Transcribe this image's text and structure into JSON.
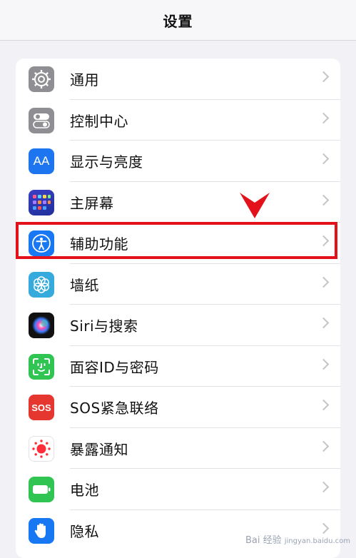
{
  "header": {
    "title": "设置"
  },
  "settings": {
    "items": [
      {
        "label": "通用",
        "icon": "gear-icon"
      },
      {
        "label": "控制中心",
        "icon": "toggles-icon"
      },
      {
        "label": "显示与亮度",
        "icon": "text-size-icon",
        "icon_text": "AA"
      },
      {
        "label": "主屏幕",
        "icon": "home-grid-icon"
      },
      {
        "label": "辅助功能",
        "icon": "accessibility-icon"
      },
      {
        "label": "墙纸",
        "icon": "flower-icon"
      },
      {
        "label": "Siri与搜索",
        "icon": "siri-icon"
      },
      {
        "label": "面容ID与密码",
        "icon": "face-id-icon"
      },
      {
        "label": "SOS紧急联络",
        "icon": "sos-icon",
        "icon_text": "SOS"
      },
      {
        "label": "暴露通知",
        "icon": "exposure-icon"
      },
      {
        "label": "电池",
        "icon": "battery-icon"
      },
      {
        "label": "隐私",
        "icon": "hand-icon"
      }
    ]
  },
  "annotation": {
    "highlighted_item": "辅助功能",
    "color": "#e3111a"
  },
  "watermark": {
    "text": "Bai 经验",
    "subtext": "jingyan.baidu.com"
  }
}
